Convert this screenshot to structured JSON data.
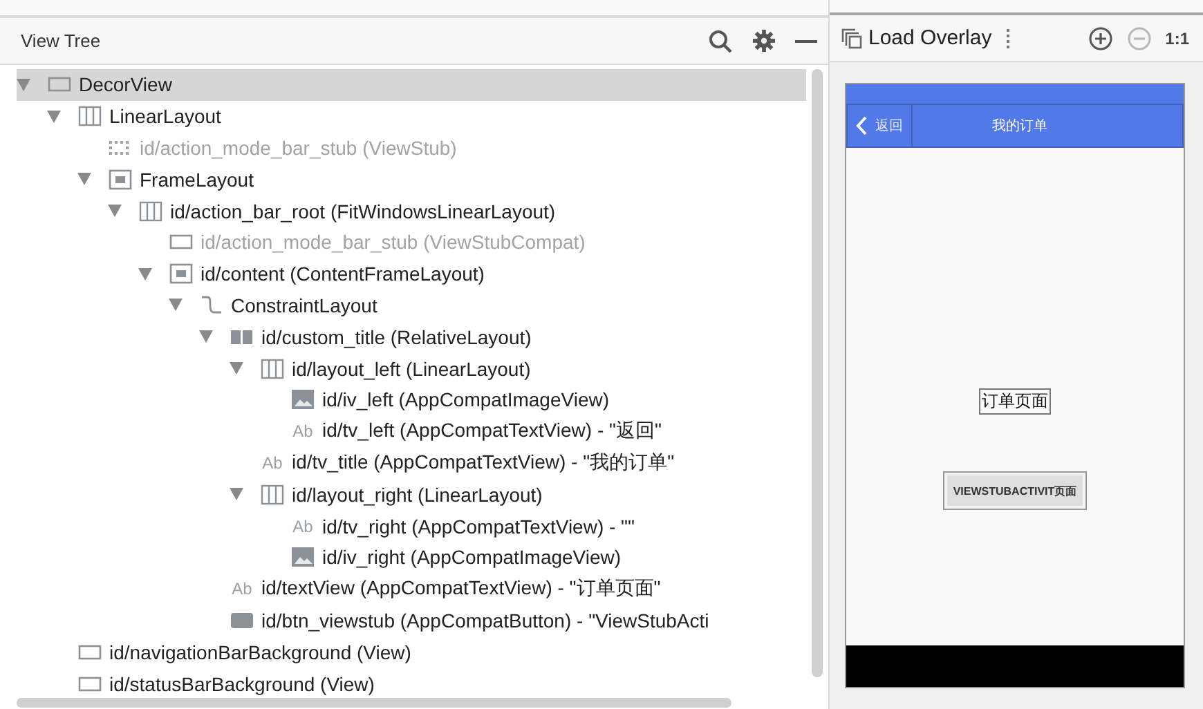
{
  "panel": {
    "title": "View Tree"
  },
  "tree": [
    {
      "label": "DecorView",
      "kind": "window",
      "selected": true,
      "disabled": false,
      "expanded": true,
      "children": [
        {
          "label": "LinearLayout",
          "kind": "linear",
          "selected": false,
          "disabled": false,
          "expanded": true,
          "children": [
            {
              "label": "id/action_mode_bar_stub (ViewStub)",
              "kind": "stub",
              "selected": false,
              "disabled": true
            },
            {
              "label": "FrameLayout",
              "kind": "frame",
              "selected": false,
              "disabled": false,
              "expanded": true,
              "children": [
                {
                  "label": "id/action_bar_root (FitWindowsLinearLayout)",
                  "kind": "linear",
                  "selected": false,
                  "disabled": false,
                  "expanded": true,
                  "children": [
                    {
                      "label": "id/action_mode_bar_stub (ViewStubCompat)",
                      "kind": "window",
                      "selected": false,
                      "disabled": true
                    },
                    {
                      "label": "id/content (ContentFrameLayout)",
                      "kind": "frame",
                      "selected": false,
                      "disabled": false,
                      "expanded": true,
                      "children": [
                        {
                          "label": "ConstraintLayout",
                          "kind": "constraint",
                          "selected": false,
                          "disabled": false,
                          "expanded": true,
                          "children": [
                            {
                              "label": "id/custom_title (RelativeLayout)",
                              "kind": "relative",
                              "selected": false,
                              "disabled": false,
                              "expanded": true,
                              "children": [
                                {
                                  "label": "id/layout_left (LinearLayout)",
                                  "kind": "linear",
                                  "selected": false,
                                  "disabled": false,
                                  "expanded": true,
                                  "children": [
                                    {
                                      "label": "id/iv_left (AppCompatImageView)",
                                      "kind": "image",
                                      "selected": false,
                                      "disabled": false
                                    },
                                    {
                                      "label": "id/tv_left (AppCompatTextView) - \"返回\"",
                                      "kind": "text",
                                      "badge": "Ab",
                                      "selected": false,
                                      "disabled": false
                                    }
                                  ]
                                },
                                {
                                  "label": "id/tv_title (AppCompatTextView) - \"我的订单\"",
                                  "kind": "text",
                                  "badge": "Ab",
                                  "selected": false,
                                  "disabled": false
                                },
                                {
                                  "label": "id/layout_right (LinearLayout)",
                                  "kind": "linear",
                                  "selected": false,
                                  "disabled": false,
                                  "expanded": true,
                                  "children": [
                                    {
                                      "label": "id/tv_right (AppCompatTextView) - \"\"",
                                      "kind": "text",
                                      "badge": "Ab",
                                      "selected": false,
                                      "disabled": false
                                    },
                                    {
                                      "label": "id/iv_right (AppCompatImageView)",
                                      "kind": "image",
                                      "selected": false,
                                      "disabled": false
                                    }
                                  ]
                                }
                              ]
                            },
                            {
                              "label": "id/textView (AppCompatTextView) - \"订单页面\"",
                              "kind": "text",
                              "badge": "Ab",
                              "selected": false,
                              "disabled": false
                            },
                            {
                              "label": "id/btn_viewstub (AppCompatButton) - \"ViewStubActi",
                              "kind": "button",
                              "selected": false,
                              "disabled": false
                            }
                          ]
                        }
                      ]
                    }
                  ]
                }
              ]
            }
          ]
        },
        {
          "label": "id/navigationBarBackground (View)",
          "kind": "window",
          "selected": false,
          "disabled": false
        },
        {
          "label": "id/statusBarBackground (View)",
          "kind": "window",
          "selected": false,
          "disabled": false
        }
      ]
    }
  ],
  "overlay_toolbar": {
    "load_button": "Load Overlay",
    "zoom_buttons": [
      {
        "kind": "zoom-in",
        "disabled": false
      },
      {
        "kind": "zoom-out",
        "disabled": true
      }
    ],
    "actual_size": "1:1"
  },
  "preview": {
    "back_label": "返回",
    "title": "我的订单",
    "text": "订单页面",
    "button": "VIEWSTUBACTIVIT页面"
  }
}
